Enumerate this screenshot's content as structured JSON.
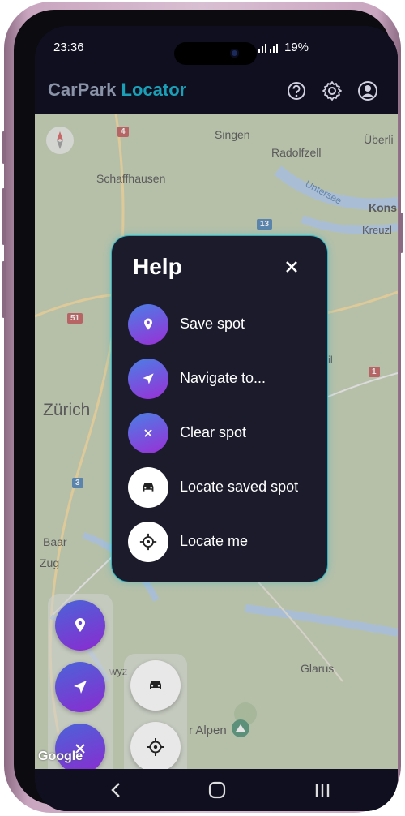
{
  "status_bar": {
    "time": "23:36",
    "signal_icon": "signal-icon",
    "battery_text": "19%"
  },
  "app_bar": {
    "title_part1": "CarPark",
    "title_part2": "Locator",
    "title_color_part1": "#8b93a8",
    "title_color_part2": "#1a9fb7",
    "icons": [
      "help-icon",
      "settings-icon",
      "account-icon"
    ]
  },
  "map": {
    "places": [
      {
        "name": "Singen"
      },
      {
        "name": "Radolfzell"
      },
      {
        "name": "Überli"
      },
      {
        "name": "Schaffhausen"
      },
      {
        "name": "Untersee"
      },
      {
        "name": "Kons"
      },
      {
        "name": "Kreuzl"
      },
      {
        "name": "Zürich"
      },
      {
        "name": "Baar"
      },
      {
        "name": "Zug"
      },
      {
        "name": "Glarus"
      },
      {
        "name": "r Alpen"
      },
      {
        "name": "wyz"
      },
      {
        "name": "il"
      }
    ],
    "road_badges": [
      "4",
      "13",
      "51",
      "1",
      "3"
    ],
    "attribution": "Google"
  },
  "help_dialog": {
    "title": "Help",
    "close_icon": "close-icon",
    "items": [
      {
        "label": "Save spot",
        "icon": "location-pin-icon",
        "style": "gradient"
      },
      {
        "label": "Navigate to...",
        "icon": "navigation-arrow-icon",
        "style": "gradient"
      },
      {
        "label": "Clear spot",
        "icon": "clear-x-icon",
        "style": "gradient"
      },
      {
        "label": "Locate saved spot",
        "icon": "car-icon",
        "style": "white"
      },
      {
        "label": "Locate me",
        "icon": "crosshair-icon",
        "style": "white"
      }
    ]
  },
  "fabs": {
    "left_group": [
      "location-pin-icon",
      "navigation-arrow-icon",
      "clear-x-icon"
    ],
    "right_group": [
      "car-icon",
      "crosshair-icon"
    ]
  },
  "nav_bar": {
    "buttons": [
      "back-icon",
      "home-icon",
      "recents-icon"
    ]
  },
  "colors": {
    "accent": "#2bb3c2",
    "gradient_start": "#4a64d8",
    "gradient_end": "#8b2bd0",
    "dialog_bg": "#1b1b2c"
  }
}
